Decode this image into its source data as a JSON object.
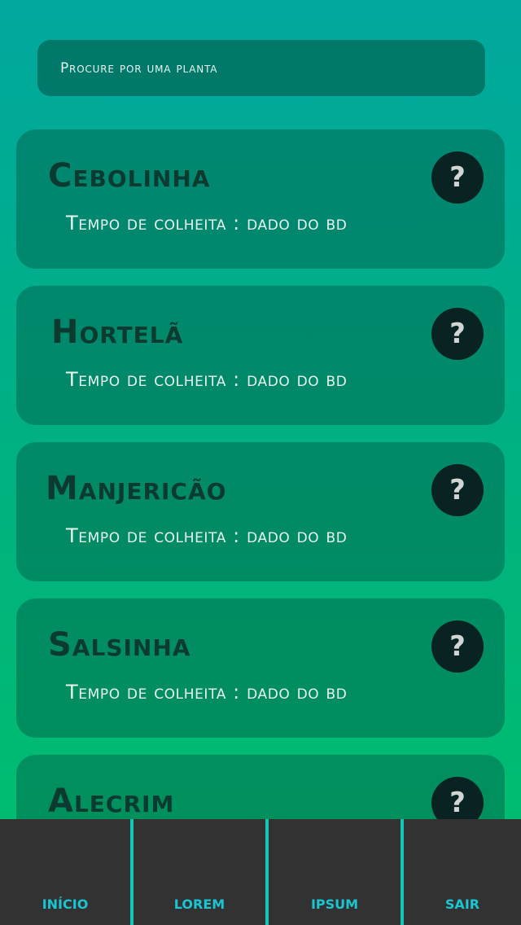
{
  "search": {
    "placeholder": "Procure por uma planta"
  },
  "plants": [
    {
      "name": "Cebolinha",
      "harvest": "Tempo de colheita : dado do bd"
    },
    {
      "name": "Hortelã",
      "harvest": "Tempo de colheita : dado do bd"
    },
    {
      "name": "Manjericão",
      "harvest": "Tempo de colheita : dado do bd"
    },
    {
      "name": "Salsinha",
      "harvest": "Tempo de colheita : dado do bd"
    },
    {
      "name": "Alecrim",
      "harvest": ""
    }
  ],
  "help_glyph": "?",
  "nav": {
    "items": [
      {
        "label": "INÍCIO"
      },
      {
        "label": "LOREM"
      },
      {
        "label": "IPSUM"
      },
      {
        "label": "SAIR"
      }
    ]
  },
  "colors": {
    "gradient_top": "#00a89e",
    "gradient_bottom": "#00c06c",
    "nav_background": "#323232",
    "nav_accent": "#19c6d2",
    "help_button": "#082321",
    "title_text": "#0b3a31"
  },
  "icons": {
    "help": "question-mark-icon"
  }
}
